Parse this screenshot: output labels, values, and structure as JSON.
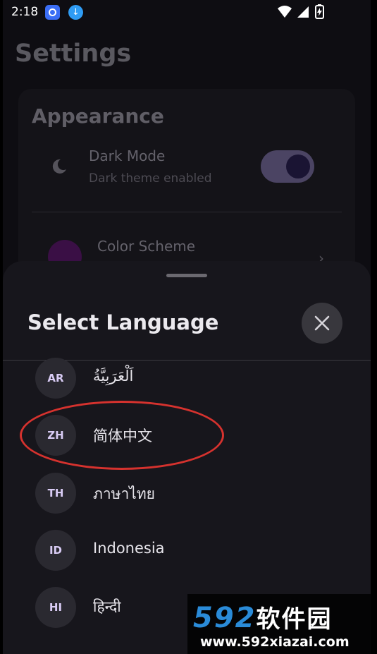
{
  "status_bar": {
    "time": "2:18",
    "icons": [
      "messenger-icon",
      "download-icon",
      "wifi-icon",
      "signal-icon",
      "battery-charging-icon"
    ]
  },
  "settings": {
    "title": "Settings",
    "appearance": {
      "title": "Appearance",
      "dark_mode": {
        "label": "Dark Mode",
        "subtitle": "Dark theme enabled",
        "enabled": true
      },
      "color_scheme": {
        "label": "Color Scheme"
      }
    }
  },
  "language_sheet": {
    "title": "Select Language",
    "items": [
      {
        "code": "AR",
        "name": "اَلْعَرَبِيَّةُ"
      },
      {
        "code": "ZH",
        "name": "简体中文"
      },
      {
        "code": "TH",
        "name": "ภาษาไทย"
      },
      {
        "code": "ID",
        "name": "Indonesia"
      },
      {
        "code": "HI",
        "name": "हिन्दी"
      }
    ]
  },
  "watermark": {
    "logo_num": "592",
    "logo_text": "软件园",
    "url": "www.592xiazai.com"
  },
  "colors": {
    "background": "#0e0d12",
    "sheet": "#17161c",
    "badge_text": "#d9ccf5",
    "annotation": "#d6322e",
    "watermark_blue": "#2a8bd8"
  }
}
